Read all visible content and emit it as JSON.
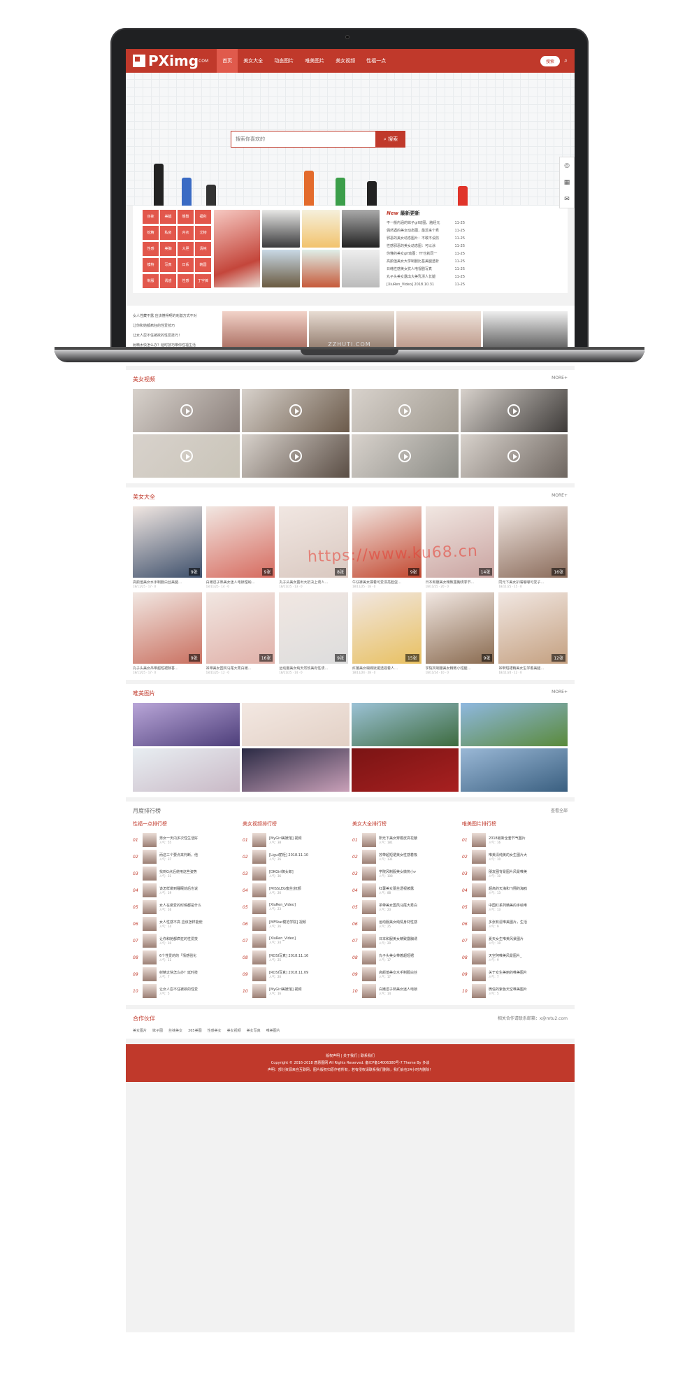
{
  "brand": {
    "logo": "PXimg",
    "logo_sup": "COM",
    "laptop_label": "ZZHUTI.COM"
  },
  "nav": {
    "items": [
      "首页",
      "美女大全",
      "动态图片",
      "唯美图片",
      "美女视频",
      "性福一点"
    ],
    "active": 0,
    "search_pill": "搜索"
  },
  "hero": {
    "search_placeholder": "搜索你喜欢的",
    "search_button": "搜索"
  },
  "tags": [
    "丝袜",
    "美腿",
    "翘臀",
    "福利",
    "蛇精",
    "私房",
    "内衣",
    "尤物",
    "性感",
    "美胸",
    "大胆",
    "清纯",
    "模特",
    "写真",
    "日系",
    "韩国",
    "制服",
    "诱惑",
    "性感",
    "丁字裤"
  ],
  "latest": {
    "title_prefix": "New",
    "title": "最新更新",
    "items": [
      {
        "t": "不一般内涵的妹子gif动图，脑经元",
        "d": "11-25"
      },
      {
        "t": "偶然遇的美女动态图，最近来个秀",
        "d": "11-25"
      },
      {
        "t": "邪恶的美女动态图片：不敢不设防",
        "d": "11-25"
      },
      {
        "t": "性感邪恶的美女动态图：可以涂",
        "d": "11-25"
      },
      {
        "t": "你懂的美女gif动图：TT也就同一",
        "d": "11-25"
      },
      {
        "t": "高颜值美女大学制服比基美腿透析",
        "d": "11-25"
      },
      {
        "t": "日韩性感美女犹人电视剧写真",
        "d": "11-25"
      },
      {
        "t": "丸子头美女露出大美乳漂人长腿",
        "d": "11-25"
      },
      {
        "t": "[XiuRen_Video] 2018.10.31",
        "d": "11-25"
      }
    ]
  },
  "sidebar_tips": [
    "女人性藏不露 应该懂得啊的刺激方式不对",
    "让你和她都疯狂的性爱技巧",
    "让女人忍不住被欲的性爱技巧！",
    "射精太快怎么办？延时技巧带你性福生活",
    "4招就阻的你的前戏：最前消出你娇喘中"
  ],
  "sections": {
    "video": "美女视频",
    "girls": "美女大全",
    "pretty": "唯美图片",
    "rank": "月度排行榜",
    "partners": "合作伙伴",
    "more": "MORE+",
    "rank_more": "查看全部"
  },
  "girls": [
    {
      "t": "高颜值美女水手制服白丝美腿…",
      "c": "9张",
      "m": "18/11/25 · 17 · 0"
    },
    {
      "t": "白嫩逗子熟美女迷人电锁理纳…",
      "c": "9张",
      "m": "18/11/25 · 14 · 0"
    },
    {
      "t": "丸子头美女露出大奶决上诱人…",
      "c": "8张",
      "m": "18/11/25 · 13 · 0"
    },
    {
      "t": "牛仔裤美女撑着可爱漂亮脸蛋…",
      "c": "9张",
      "m": "18/11/25 · 18 · 0"
    },
    {
      "t": "日本和服美女精致露胸诱季节…",
      "c": "14张",
      "m": "18/11/25 · 20 · 0"
    },
    {
      "t": "同元下美女扒嘴嘟嘟可爱子…",
      "c": "16张",
      "m": "18/11/25 · 15 · 0"
    },
    {
      "t": "丸子头美女吊带超短裙酥香…",
      "c": "9张",
      "m": "18/11/25 · 17 · 0"
    },
    {
      "t": "吊带美女国风马尾大秀白嫩…",
      "c": "16张",
      "m": "18/11/25 · 12 · 0"
    },
    {
      "t": "运动服美女纯天然软美有性诱…",
      "c": "9张",
      "m": "18/11/25 · 14 · 0"
    },
    {
      "t": "红薯美女蝴蝶妩媚透视着人…",
      "c": "15张",
      "m": "18/11/24 · 28 · 0"
    },
    {
      "t": "学院风制服美女精致小短腿…",
      "c": "9张",
      "m": "18/11/24 · 10 · 0"
    },
    {
      "t": "吊带短裙精美女生学着美腿…",
      "c": "12张",
      "m": "18/11/24 · 12 · 0"
    }
  ],
  "watermark": "https://www.ku68.cn",
  "rank": [
    {
      "title": "性福一点排行榜",
      "items": [
        [
          "男女一天内多次性生活好",
          "55"
        ],
        [
          "而这三个要点来判断，他",
          "37"
        ],
        [
          "找到G点后使用这些姿势",
          "31"
        ],
        [
          "该怎样做到睡眠前后也说",
          "19"
        ],
        [
          "女人在做爱的时候都是什么",
          "16"
        ],
        [
          "女人性感不高 应该怎样能使",
          "14"
        ],
        [
          "让你和她都疯狂的性爱技",
          "10"
        ],
        [
          "6个性爱的的「情感强化",
          "11"
        ],
        [
          "射精太快怎么办？延时技",
          "7"
        ],
        [
          "让女人忍不住被欲的性爱",
          "5"
        ]
      ]
    },
    {
      "title": "美女视频排行榜",
      "items": [
        [
          "[MyGirl美媛馆] 视频",
          "38"
        ],
        [
          "[Ligui丽柜] 2018.11.10",
          "26"
        ],
        [
          "[DKGirl御女郎]",
          "36"
        ],
        [
          "[MISSLEG蜜丝]抚额",
          "26"
        ],
        [
          "[XiuRen_Video]",
          "23"
        ],
        [
          "[MFStar模范学院] 视频",
          "26"
        ],
        [
          "[XiuRen_Video]",
          "24"
        ],
        [
          "[ROSI写真] 2018.11.16",
          "25"
        ],
        [
          "[ROSI写真] 2018.11.09",
          "20"
        ],
        [
          "[MyGirl美媛馆] 视频",
          "16"
        ]
      ]
    },
    {
      "title": "美女大全排行榜",
      "items": [
        [
          "阳光下美女穿着皮高花蔽",
          "181"
        ],
        [
          "苏带超短裙美女性感着吸",
          "131"
        ],
        [
          "学院风制服美女微热小v",
          "108"
        ],
        [
          "红薯美女蕾丝透视披露",
          "88"
        ],
        [
          "吊带美女国风马尾大秀白",
          "23"
        ],
        [
          "运动服美女纯情身材性感",
          "25"
        ],
        [
          "日本和服美女精致露胸诱",
          "20"
        ],
        [
          "丸子头美女带着超短裙",
          "17"
        ],
        [
          "高颜值美女水手制服白丝",
          "17"
        ],
        [
          "白嫩逗子熟美女迷人电锁",
          "14"
        ]
      ]
    },
    {
      "title": "唯美图片排行榜",
      "items": [
        [
          "2018最新全套节气图片",
          "16"
        ],
        [
          "唯美清纯美的女生图片大",
          "10"
        ],
        [
          "朋友圈背景图片风景唯美",
          "10"
        ],
        [
          "超高的天海和飞翔的海鸥",
          "13"
        ],
        [
          "中国红系列精美的手绘唯",
          "13"
        ],
        [
          "多张有逗唯美图片，生活",
          "9"
        ],
        [
          "夏天女生唯美风景图片",
          "10"
        ],
        [
          "天空阿唯美风景图片_",
          "9"
        ],
        [
          "关于女生美丽的唯美图片",
          "7"
        ],
        [
          "微信的紫色天空唯美图片",
          "5"
        ]
      ]
    }
  ],
  "rank_heat_label": "人气：",
  "partners": {
    "contact": "相关合作请联系邮箱：x@mtu2.com",
    "links": [
      "美女图片",
      "妹子图",
      "丝袜美女",
      "365美图",
      "性感美女",
      "美女视频",
      "美女写真",
      "唯美图片"
    ]
  },
  "footer": {
    "links": "版权声明 | 关于我们 | 联系我们",
    "copy": "Copyright © 2016-2018 唐惠图网 All Rights Reserved. 备ICP备14006380号-7.Theme By 多谈",
    "notice": "声明：部分资源来自互联网，图片版权归原作者所有，若有侵权请联系我们删除，我们会在24小时内删除！"
  },
  "side_tools": [
    "rss-icon",
    "qrcode-icon",
    "mail-icon"
  ]
}
